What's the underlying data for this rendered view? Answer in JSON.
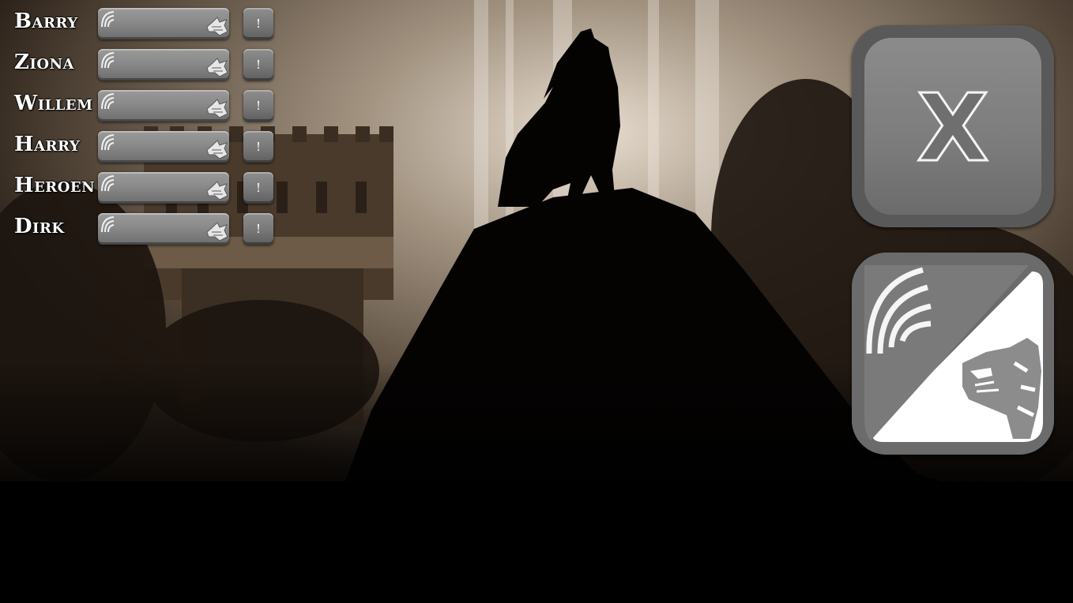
{
  "players": [
    {
      "name": "Barry",
      "info_label": "!"
    },
    {
      "name": "Ziona",
      "info_label": "!"
    },
    {
      "name": "Willem",
      "info_label": "!"
    },
    {
      "name": "Harry",
      "info_label": "!"
    },
    {
      "name": "Heroen",
      "info_label": "!"
    },
    {
      "name": "Dirk",
      "info_label": "!"
    }
  ],
  "close_button": {
    "label": "X"
  },
  "role_button": {
    "icons": [
      "hunter-mark-icon",
      "wolf-head-icon"
    ]
  },
  "colors": {
    "button_gray": "#7c7c7c",
    "sepia": "#8a7a66",
    "text": "#ffffff"
  }
}
